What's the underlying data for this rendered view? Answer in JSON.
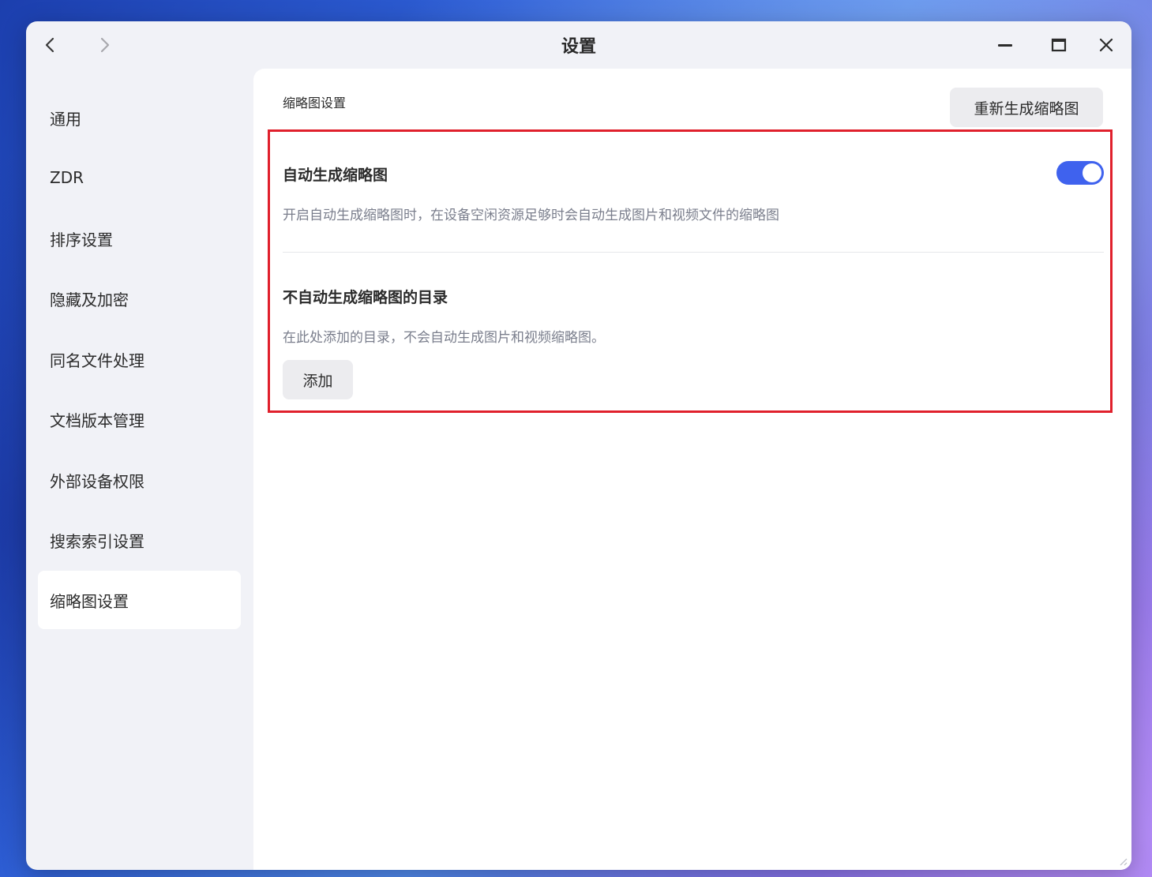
{
  "window": {
    "title": "设置"
  },
  "sidebar": {
    "items": [
      {
        "label": "通用"
      },
      {
        "label": "ZDR"
      },
      {
        "label": "排序设置"
      },
      {
        "label": "隐藏及加密"
      },
      {
        "label": "同名文件处理"
      },
      {
        "label": "文档版本管理"
      },
      {
        "label": "外部设备权限"
      },
      {
        "label": "搜索索引设置"
      },
      {
        "label": "缩略图设置"
      }
    ],
    "active_index": 8
  },
  "main": {
    "section_title": "缩略图设置",
    "regenerate_button": "重新生成缩略图",
    "auto_generate": {
      "title": "自动生成缩略图",
      "description": "开启自动生成缩略图时，在设备空闲资源足够时会自动生成图片和视频文件的缩略图",
      "enabled": true
    },
    "excluded_dirs": {
      "title": "不自动生成缩略图的目录",
      "description": "在此处添加的目录，不会自动生成图片和视频缩略图。",
      "add_button": "添加"
    }
  },
  "colors": {
    "accent": "#3f62ee",
    "highlight_border": "#e0202c",
    "description_text": "#7a7e8c"
  },
  "icons": [
    "back-icon",
    "forward-icon",
    "minimize-icon",
    "maximize-icon",
    "close-icon",
    "resize-grip-icon"
  ]
}
